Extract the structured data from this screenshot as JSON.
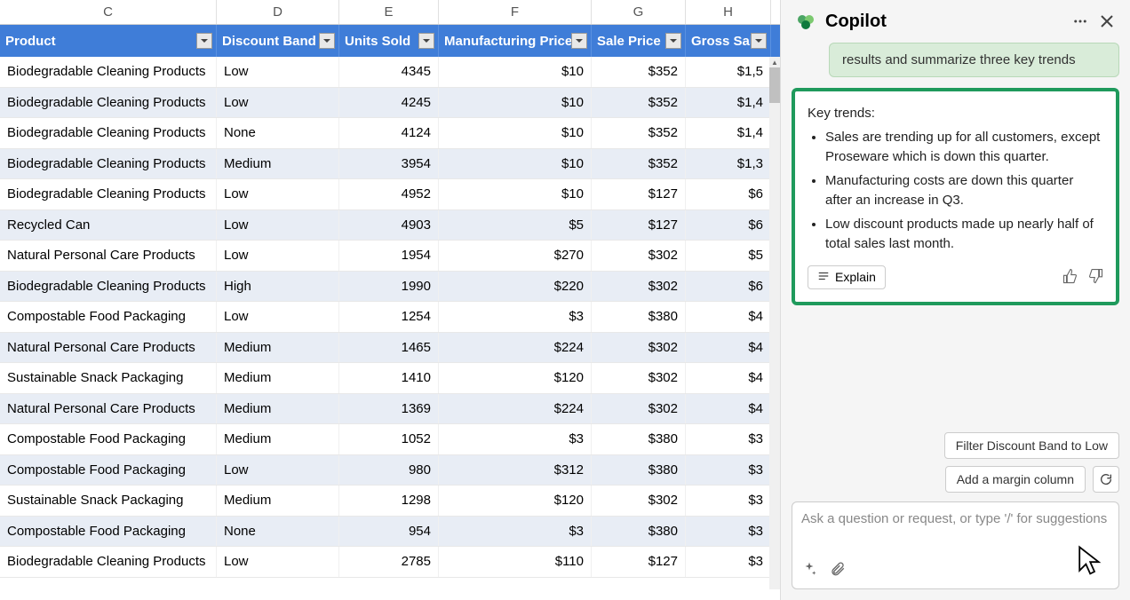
{
  "columns": {
    "C": "C",
    "D": "D",
    "E": "E",
    "F": "F",
    "G": "G",
    "H": "H"
  },
  "headers": {
    "product": "Product",
    "discount_band": "Discount Band",
    "units_sold": "Units Sold",
    "mfg_price": "Manufacturing Price",
    "sale_price": "Sale Price",
    "gross_sales": "Gross Sale"
  },
  "rows": [
    {
      "product": "Biodegradable Cleaning Products",
      "band": "Low",
      "units": "4345",
      "mfg": "$10",
      "sale": "$352",
      "gross": "$1,5"
    },
    {
      "product": "Biodegradable Cleaning Products",
      "band": "Low",
      "units": "4245",
      "mfg": "$10",
      "sale": "$352",
      "gross": "$1,4"
    },
    {
      "product": "Biodegradable Cleaning Products",
      "band": "None",
      "units": "4124",
      "mfg": "$10",
      "sale": "$352",
      "gross": "$1,4"
    },
    {
      "product": "Biodegradable Cleaning Products",
      "band": "Medium",
      "units": "3954",
      "mfg": "$10",
      "sale": "$352",
      "gross": "$1,3"
    },
    {
      "product": "Biodegradable Cleaning Products",
      "band": "Low",
      "units": "4952",
      "mfg": "$10",
      "sale": "$127",
      "gross": "$6"
    },
    {
      "product": "Recycled Can",
      "band": "Low",
      "units": "4903",
      "mfg": "$5",
      "sale": "$127",
      "gross": "$6"
    },
    {
      "product": "Natural Personal Care Products",
      "band": "Low",
      "units": "1954",
      "mfg": "$270",
      "sale": "$302",
      "gross": "$5"
    },
    {
      "product": "Biodegradable Cleaning Products",
      "band": "High",
      "units": "1990",
      "mfg": "$220",
      "sale": "$302",
      "gross": "$6"
    },
    {
      "product": "Compostable Food Packaging",
      "band": "Low",
      "units": "1254",
      "mfg": "$3",
      "sale": "$380",
      "gross": "$4"
    },
    {
      "product": "Natural Personal Care Products",
      "band": "Medium",
      "units": "1465",
      "mfg": "$224",
      "sale": "$302",
      "gross": "$4"
    },
    {
      "product": "Sustainable Snack Packaging",
      "band": "Medium",
      "units": "1410",
      "mfg": "$120",
      "sale": "$302",
      "gross": "$4"
    },
    {
      "product": "Natural Personal Care Products",
      "band": "Medium",
      "units": "1369",
      "mfg": "$224",
      "sale": "$302",
      "gross": "$4"
    },
    {
      "product": "Compostable Food Packaging",
      "band": "Medium",
      "units": "1052",
      "mfg": "$3",
      "sale": "$380",
      "gross": "$3"
    },
    {
      "product": "Compostable Food Packaging",
      "band": "Low",
      "units": "980",
      "mfg": "$312",
      "sale": "$380",
      "gross": "$3"
    },
    {
      "product": "Sustainable Snack Packaging",
      "band": "Medium",
      "units": "1298",
      "mfg": "$120",
      "sale": "$302",
      "gross": "$3"
    },
    {
      "product": "Compostable Food Packaging",
      "band": "None",
      "units": "954",
      "mfg": "$3",
      "sale": "$380",
      "gross": "$3"
    },
    {
      "product": "Biodegradable Cleaning Products",
      "band": "Low",
      "units": "2785",
      "mfg": "$110",
      "sale": "$127",
      "gross": "$3"
    }
  ],
  "copilot": {
    "title": "Copilot",
    "prompt": "results and summarize three key trends",
    "response_heading": "Key trends:",
    "bullets": [
      "Sales are trending up for all customers, except Proseware which is down this quarter.",
      "Manufacturing costs are down this quarter after an increase in Q3.",
      "Low discount products made up nearly half of total sales last month."
    ],
    "explain_label": "Explain",
    "suggestion1": "Filter Discount Band to Low",
    "suggestion2": "Add a margin column",
    "input_placeholder": "Ask a question or request, or type '/' for suggestions"
  }
}
